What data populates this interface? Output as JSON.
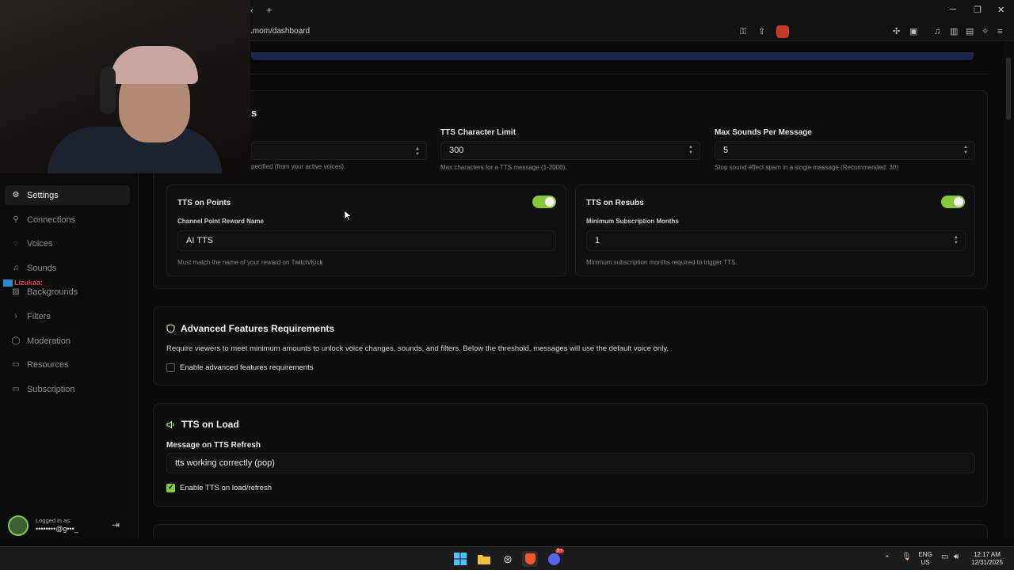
{
  "browser": {
    "url": ".mom/dashboard",
    "new_tab": "+",
    "icons": [
      "back-icon",
      "key-icon",
      "share-icon",
      "brave-shield-icon",
      "extensions-icon",
      "tab-icon",
      "music-icon",
      "sidebar-icon",
      "wallet-icon",
      "ai-icon",
      "menu-icon"
    ]
  },
  "sidebar": {
    "items": [
      {
        "label": "Settings",
        "icon": "gear-icon",
        "active": true
      },
      {
        "label": "Connections",
        "icon": "link-icon"
      },
      {
        "label": "Voices",
        "icon": "mic-icon"
      },
      {
        "label": "Sounds",
        "icon": "music-note-icon"
      },
      {
        "label": "Backgrounds",
        "icon": "image-icon"
      },
      {
        "label": "Filters",
        "icon": "chevron-right-icon"
      },
      {
        "label": "Moderation",
        "icon": "shield-icon"
      },
      {
        "label": "Resources",
        "icon": "book-icon"
      },
      {
        "label": "Subscription",
        "icon": "card-icon"
      }
    ],
    "chat_overlay": "Lizukaa:",
    "logged_in_label": "Logged in as:",
    "logged_in_value": "••••••••@g•••_"
  },
  "tts_settings": {
    "title_fragment": "s",
    "voice_help": "pecified (from your active voices).",
    "char_limit_label": "TTS Character Limit",
    "char_limit_value": "300",
    "char_limit_help": "Max characters for a TTS message (1-2000).",
    "max_sounds_label": "Max Sounds Per Message",
    "max_sounds_value": "5",
    "max_sounds_help": "Stop sound effect spam in a single message (Recommended: 30)",
    "points": {
      "title": "TTS on Points",
      "enabled": true,
      "field_label": "Channel Point Reward Name",
      "field_value": "AI TTS",
      "help": "Must match the name of your reward on Twitch/Kick"
    },
    "resubs": {
      "title": "TTS on Resubs",
      "enabled": true,
      "field_label": "Minimum Subscription Months",
      "field_value": "1",
      "help": "Minimum subscription months required to trigger TTS."
    }
  },
  "advanced": {
    "title": "Advanced Features Requirements",
    "description": "Require viewers to meet minimum amounts to unlock voice changes, sounds, and filters. Below the threshold, messages will use the default voice only.",
    "checkbox_label": "Enable advanced features requirements",
    "checked": false
  },
  "tts_load": {
    "title": "TTS on Load",
    "field_label": "Message on TTS Refresh",
    "field_value": "tts working correctly (pop)",
    "checkbox_label": "Enable TTS on load/refresh",
    "checked": true
  },
  "taskbar": {
    "lang_top": "ENG",
    "lang_bottom": "US",
    "time": "12:17 AM",
    "date": "12/31/2025",
    "discord_badge": "9+"
  },
  "colors": {
    "accent": "#86c93a",
    "background": "#090909",
    "sidebar_active": "#1b1b1b"
  }
}
